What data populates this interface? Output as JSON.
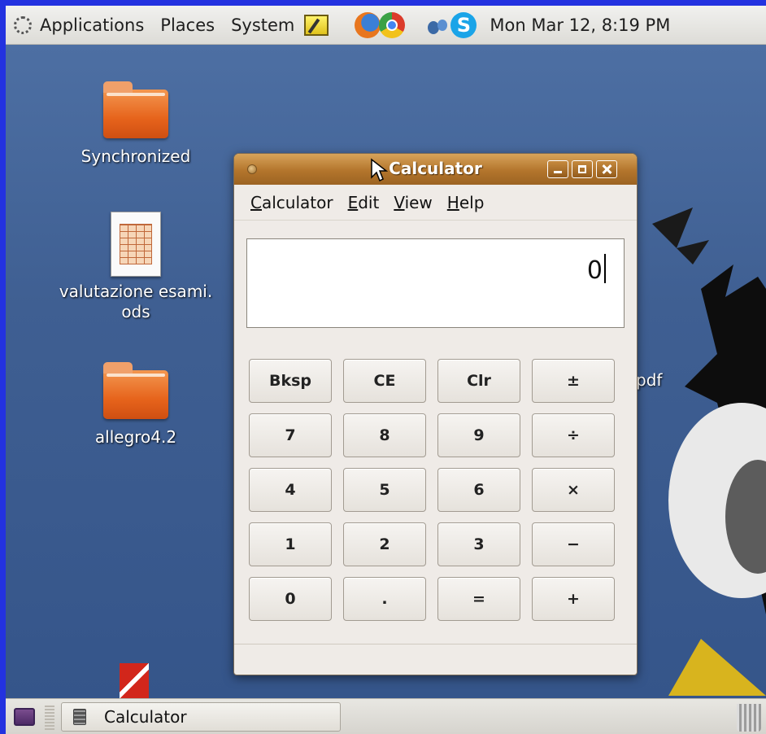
{
  "top_panel": {
    "menus": [
      "Applications",
      "Places",
      "System"
    ],
    "clock": "Mon Mar 12,  8:19 PM"
  },
  "desktop": {
    "icons": [
      {
        "label": "Synchronized",
        "type": "folder-icon"
      },
      {
        "label": "valutazione esami.\nods",
        "type": "spreadsheet-icon"
      },
      {
        "label": "allegro4.2",
        "type": "folder-icon"
      },
      {
        "label": "",
        "type": "pdf-icon"
      }
    ],
    "partial_label": "pdf"
  },
  "calculator": {
    "title": "Calculator",
    "menu": [
      {
        "label": "Calculator",
        "mnemonic": "C",
        "rest": "alculator"
      },
      {
        "label": "Edit",
        "mnemonic": "E",
        "rest": "dit"
      },
      {
        "label": "View",
        "mnemonic": "V",
        "rest": "iew"
      },
      {
        "label": "Help",
        "mnemonic": "H",
        "rest": "elp"
      }
    ],
    "display": "0",
    "keys": [
      [
        "Bksp",
        "CE",
        "Clr",
        "±"
      ],
      [
        "7",
        "8",
        "9",
        "÷"
      ],
      [
        "4",
        "5",
        "6",
        "×"
      ],
      [
        "1",
        "2",
        "3",
        "−"
      ],
      [
        "0",
        ".",
        "=",
        "+"
      ]
    ]
  },
  "taskbar": {
    "tasks": [
      {
        "label": "Calculator"
      }
    ]
  },
  "colors": {
    "titlebar": "#b3752c",
    "desktop": "#3f5f92",
    "folder": "#e6631b"
  }
}
